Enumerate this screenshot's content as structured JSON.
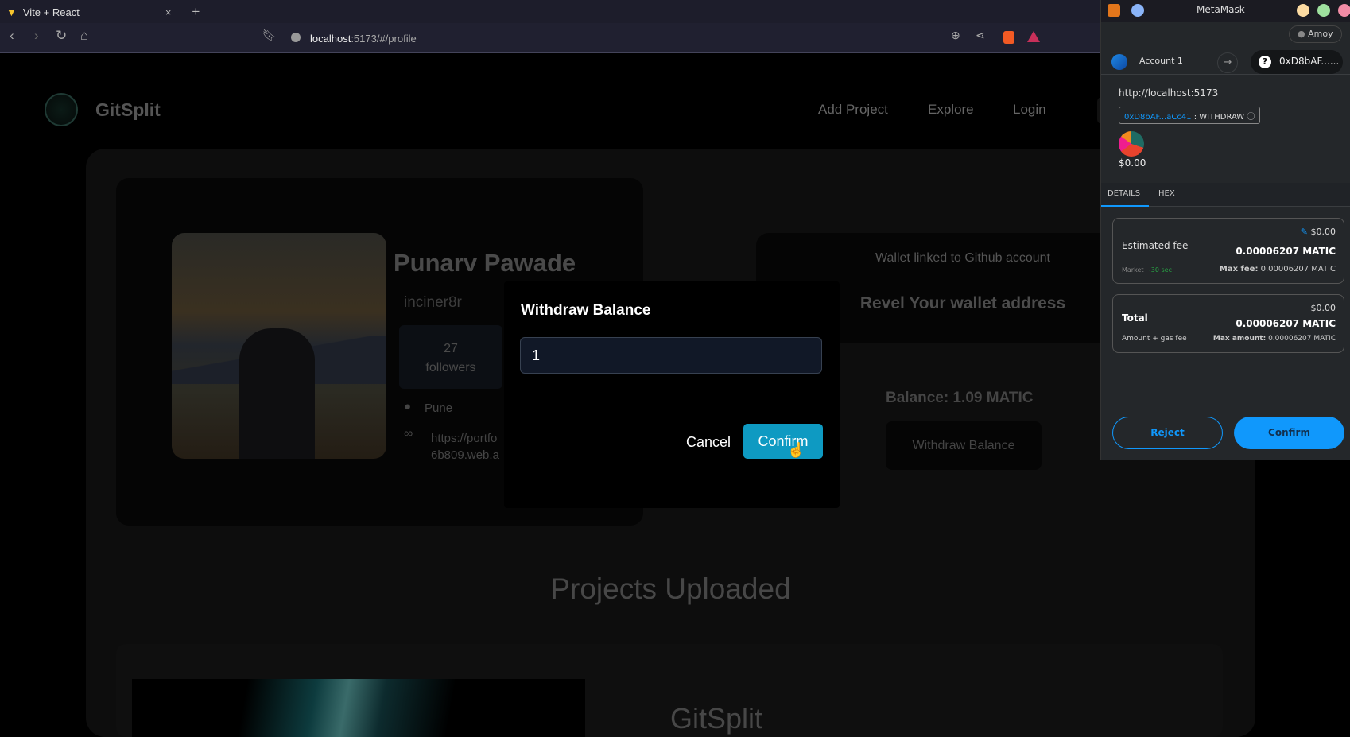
{
  "browser": {
    "tab_title": "Vite + React",
    "url_host": "localhost",
    "url_path": ":5173/#/profile"
  },
  "site": {
    "brand": "GitSplit",
    "nav": [
      "Add Project",
      "Explore",
      "Login"
    ]
  },
  "profile": {
    "name": "Punarv Pawade",
    "username": "inciner8r",
    "followers_count": "27",
    "followers_label": "followers",
    "location": "Pune",
    "link_line1": "https://portfo",
    "link_line2": "6b809.web.a"
  },
  "wallet": {
    "heading": "Wallet linked to Github account",
    "reveal": "Revel Your wallet address",
    "balance": "Balance: 1.09 MATIC",
    "withdraw_button": "Withdraw Balance"
  },
  "projects": {
    "heading": "Projects Uploaded",
    "first_title": "GitSplit"
  },
  "modal": {
    "title": "Withdraw Balance",
    "amount_value": "1",
    "cancel": "Cancel",
    "confirm": "Confirm",
    "confirm_color": "#0e9ac2"
  },
  "metamask": {
    "title": "MetaMask",
    "network": "Amoy",
    "account": "Account 1",
    "to_address": "0xD8bAF......",
    "origin": "http://localhost:5173",
    "contract": "0xD8bAF...aCc41",
    "method": ": WITHDRAW",
    "value_usd": "$0.00",
    "tabs": [
      "DETAILS",
      "HEX"
    ],
    "fee": {
      "label": "Estimated fee",
      "usd": "$0.00",
      "amount": "0.00006207 MATIC",
      "speed": "Market",
      "time": "~30 sec",
      "max_label": "Max fee:",
      "max_value": "0.00006207 MATIC"
    },
    "total": {
      "label": "Total",
      "usd": "$0.00",
      "amount": "0.00006207 MATIC",
      "sub": "Amount + gas fee",
      "max_label": "Max amount:",
      "max_value": "0.00006207 MATIC"
    },
    "reject": "Reject",
    "confirm": "Confirm",
    "accent": "#1098fc"
  }
}
